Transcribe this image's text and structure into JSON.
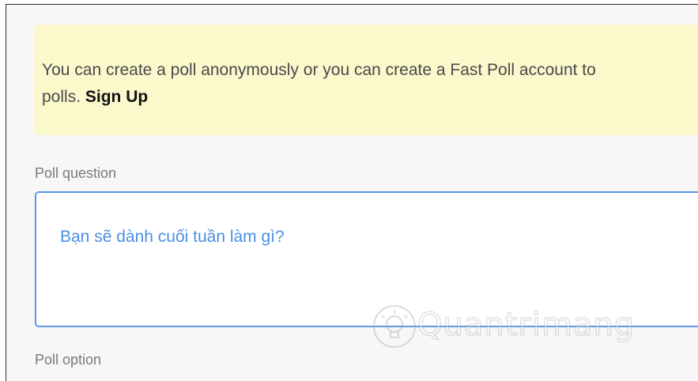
{
  "notice": {
    "line1": "You can create a poll anonymously or you can create a Fast Poll account to",
    "line2_prefix": "polls. ",
    "signup_label": "Sign Up"
  },
  "poll_question": {
    "label": "Poll question",
    "value": "Bạn sẽ dành cuối tuần làm gì?"
  },
  "poll_option": {
    "label": "Poll option"
  },
  "watermark": {
    "text": "Quantrimang",
    "icon": "lightbulb-icon"
  },
  "colors": {
    "notice_bg": "#fbf8cc",
    "accent": "#5b9ae8",
    "question_text": "#4a8fe4"
  }
}
